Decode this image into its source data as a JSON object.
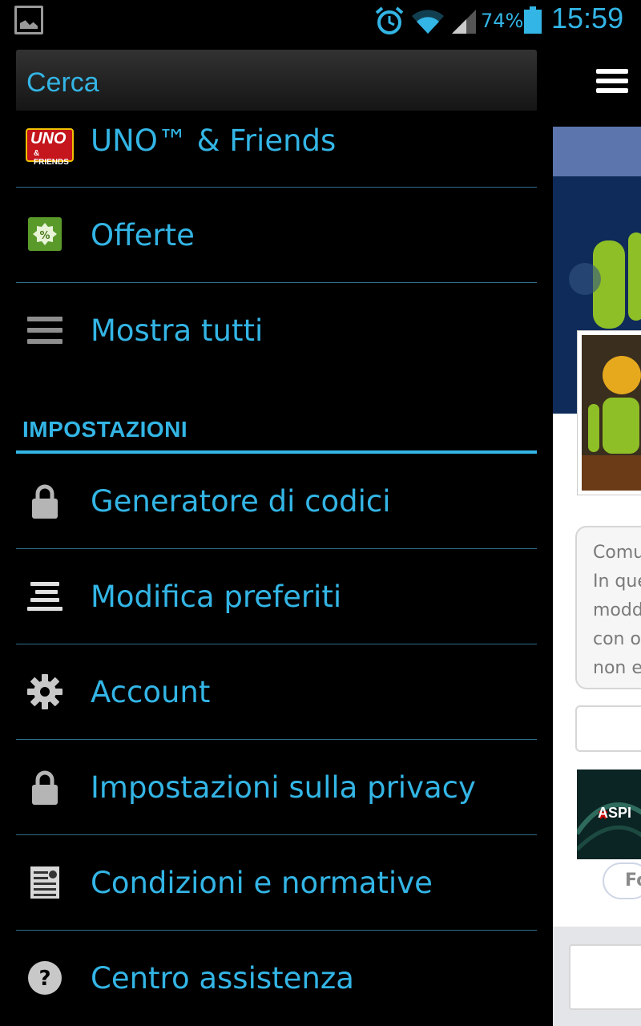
{
  "status_bar": {
    "battery_percent": "74%",
    "time": "15:59",
    "icons": [
      "gallery-notification-icon",
      "alarm-icon",
      "wifi-icon",
      "signal-icon",
      "battery-icon"
    ]
  },
  "drawer": {
    "search_label": "Cerca",
    "items_top": [
      {
        "label": "UNO™ & Friends",
        "icon": "uno-friends-app-icon"
      },
      {
        "label": "Offerte",
        "icon": "offers-icon"
      },
      {
        "label": "Mostra tutti",
        "icon": "list-icon"
      }
    ],
    "section_title": "IMPOSTAZIONI",
    "settings_items": [
      {
        "label": "Generatore di codici",
        "icon": "lock-icon"
      },
      {
        "label": "Modifica preferiti",
        "icon": "reorder-icon"
      },
      {
        "label": "Account",
        "icon": "gear-icon"
      },
      {
        "label": "Impostazioni sulla privacy",
        "icon": "lock-icon"
      },
      {
        "label": "Condizioni e normative",
        "icon": "document-icon"
      },
      {
        "label": "Centro assistenza",
        "icon": "help-icon"
      }
    ]
  },
  "peek": {
    "status_lines": [
      "Comu",
      "In que",
      "modd",
      "con o",
      "non e"
    ],
    "ad_text": "ASPI",
    "fo_text": "Fo"
  },
  "colors": {
    "accent": "#33b5e5",
    "drawer_bg": "#000000",
    "separator": "#2f6e8c"
  }
}
